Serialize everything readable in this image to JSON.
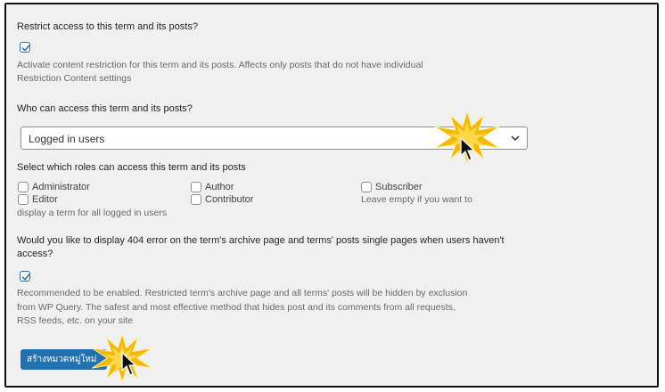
{
  "restrict": {
    "label": "Restrict access to this term and its posts?",
    "checked": true,
    "description_line1": "Activate content restriction for this term and its posts. Affects only posts that do not have individual",
    "description_line2": "Restriction Content settings"
  },
  "access": {
    "label": "Who can access this term and its posts?",
    "selected": "Logged in users"
  },
  "roles": {
    "label": "Select which roles can access this term and its posts",
    "items": [
      {
        "label": "Administrator",
        "checked": false
      },
      {
        "label": "Author",
        "checked": false
      },
      {
        "label": "Subscriber",
        "checked": false
      },
      {
        "label": "Editor",
        "checked": false
      },
      {
        "label": "Contributor",
        "checked": false
      }
    ],
    "hint_part1": "Leave empty if you want to",
    "hint_part2": "display a term for all logged in users"
  },
  "error404": {
    "label_line1": "Would you like to display 404 error on the term's archive page and terms' posts single pages when users haven't",
    "label_line2": "access?",
    "checked": true,
    "description_line1": "Recommended to be enabled. Restricted term's archive page and all terms' posts will be hidden by exclusion",
    "description_line2": "from WP Query. The safest and most effective method that hides post and its comments from all requests,",
    "description_line3": "RSS feeds, etc. on your site"
  },
  "submit": {
    "label": "สร้างหมวดหมู่ใหม่"
  },
  "colors": {
    "accent": "#2271b1",
    "highlight": "#f5b800",
    "background": "#f0f0f1"
  }
}
